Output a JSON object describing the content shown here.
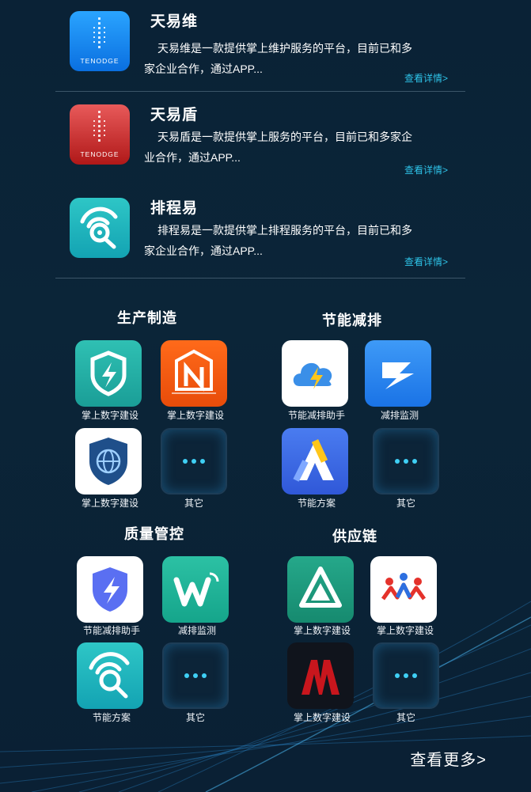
{
  "apps": [
    {
      "title": "天易维",
      "desc": "天易维是一款提供掌上维护服务的平台，目前已和多家企业合作，通过APP...",
      "link": "查看详情>",
      "icon": "tenodge-blue-logo-icon",
      "brand": "TENODGE"
    },
    {
      "title": "天易盾",
      "desc": "天易盾是一款提供掌上服务的平台，目前已和多家企业合作，通过APP...",
      "link": "查看详情>",
      "icon": "tenodge-red-logo-icon",
      "brand": "TENODGE"
    },
    {
      "title": "排程易",
      "desc": "排程易是一款提供掌上排程服务的平台，目前已和多家企业合作，通过APP...",
      "link": "查看详情>",
      "icon": "signal-search-icon"
    }
  ],
  "categories": [
    {
      "title": "生产制造",
      "items": [
        {
          "label": "掌上数字建设",
          "icon": "shield-bolt-icon"
        },
        {
          "label": "掌上数字建设",
          "icon": "n-logo-icon"
        },
        {
          "label": "掌上数字建设",
          "icon": "globe-shield-icon"
        },
        {
          "label": "其它",
          "icon": "more-dots-icon"
        }
      ]
    },
    {
      "title": "节能减排",
      "items": [
        {
          "label": "节能减排助手",
          "icon": "cloud-bolt-icon"
        },
        {
          "label": "减排监测",
          "icon": "z-bolt-icon"
        },
        {
          "label": "节能方案",
          "icon": "a-logo-icon"
        },
        {
          "label": "其它",
          "icon": "more-dots-icon"
        }
      ]
    },
    {
      "title": "质量管控",
      "items": [
        {
          "label": "节能减排助手",
          "icon": "shield-bolt-blue-icon"
        },
        {
          "label": "减排监测",
          "icon": "w-wave-icon"
        },
        {
          "label": "节能方案",
          "icon": "signal-search-icon"
        },
        {
          "label": "其它",
          "icon": "more-dots-icon"
        }
      ]
    },
    {
      "title": "供应链",
      "items": [
        {
          "label": "掌上数字建设",
          "icon": "triangle-logo-icon"
        },
        {
          "label": "掌上数字建设",
          "icon": "people-m-logo-icon"
        },
        {
          "label": "掌上数字建设",
          "icon": "m-red-logo-icon"
        },
        {
          "label": "其它",
          "icon": "more-dots-icon"
        }
      ]
    }
  ],
  "more_label": "查看更多>",
  "colors": {
    "accent": "#2ec3e8",
    "bg": "#0b2538"
  }
}
